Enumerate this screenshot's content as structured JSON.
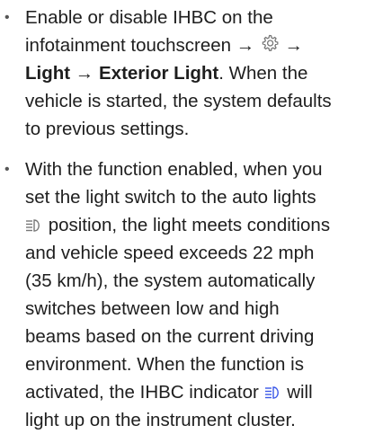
{
  "bullet_glyph": "•",
  "arrow": "→",
  "items": [
    {
      "line1": "Enable or disable IHBC on the",
      "line2_text": "infotainment touchscreen",
      "line2_icon": "gear-icon",
      "line3_bold1": "Light",
      "line3_bold2": "Exterior Light",
      "line3_rest": ". When the",
      "line4": "vehicle is started, the system defaults",
      "line5": "to previous settings."
    },
    {
      "line1": "With the function enabled, when you",
      "line2": "set the light switch to the auto lights",
      "line3_icon": "auto-high-beam-icon",
      "line3_text": " position, the light meets conditions",
      "line4": "and vehicle speed exceeds 22 mph",
      "line5": "(35 km/h), the system automatically",
      "line6": "switches between low and high",
      "line7": "beams based on the current driving",
      "line8": "environment. When the function is",
      "line9_pre": "activated, the IHBC indicator ",
      "line9_icon": "ihbc-indicator-icon",
      "line9_post": " will",
      "line10": "light up on the instrument cluster."
    }
  ],
  "colors": {
    "text": "#1e1e1e",
    "indicator": "#3a57e8",
    "icon_gray": "#777777"
  }
}
